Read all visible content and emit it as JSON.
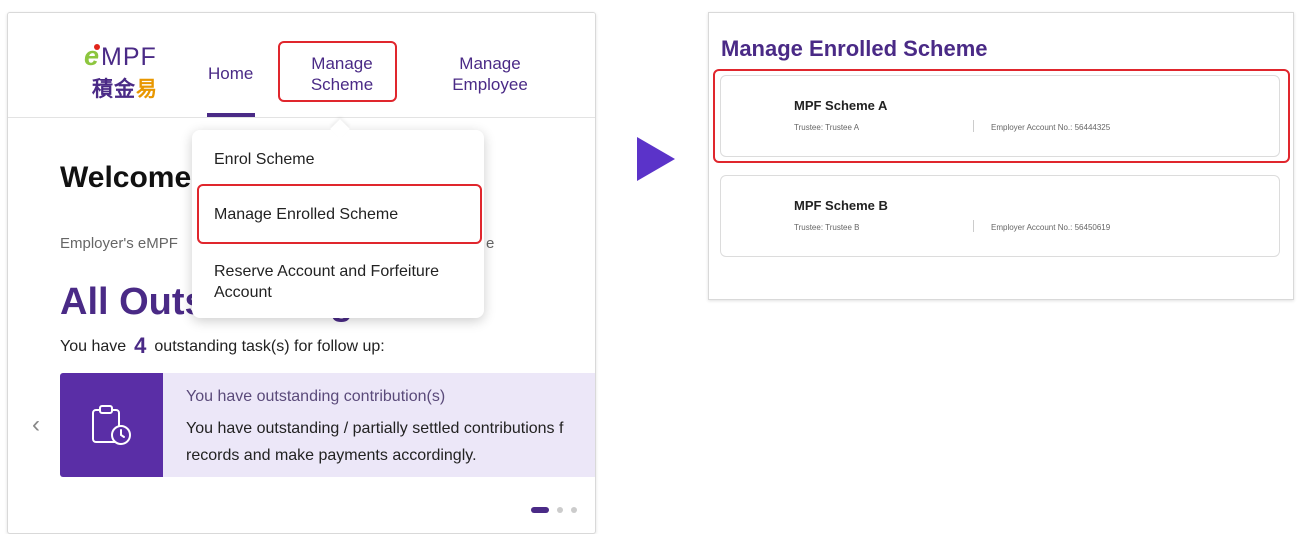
{
  "left": {
    "logo": {
      "brand": "MPF",
      "brand_e": "e",
      "chinese_1": "積金",
      "chinese_2": "易"
    },
    "nav": {
      "home": "Home",
      "manage_scheme": "Manage Scheme",
      "manage_employee": "Manage Employee"
    },
    "welcome": "Welcome",
    "subtitle_start": "Employer's eMPF",
    "subtitle_end": "e",
    "section_title_start": "All Outs",
    "section_title_end": "g",
    "tasks_prefix": "You have",
    "tasks_count": "4",
    "tasks_suffix": "outstanding task(s) for follow up:",
    "card": {
      "title": "You have outstanding contribution(s)",
      "body_line1": "You have outstanding / partially settled contributions f",
      "body_line2": "records and make payments accordingly.",
      "icon": "clipboard-clock-icon"
    },
    "carousel_prev": "‹",
    "dropdown": {
      "items": [
        "Enrol Scheme",
        "Manage Enrolled Scheme",
        "Reserve Account and Forfeiture Account"
      ]
    }
  },
  "arrow_icon": "play-arrow-icon",
  "right": {
    "title": "Manage Enrolled Scheme",
    "schemes": [
      {
        "name": "MPF Scheme A",
        "trustee": "Trustee: Trustee A",
        "account": "Employer Account No.: 56444325"
      },
      {
        "name": "MPF Scheme B",
        "trustee": "Trustee: Trustee B",
        "account": "Employer Account No.: 56450619"
      }
    ]
  },
  "colors": {
    "brand_purple": "#4a2a86",
    "highlight_red": "#e0262d",
    "card_bg": "#ece7f8",
    "arrow": "#5b33c9"
  }
}
